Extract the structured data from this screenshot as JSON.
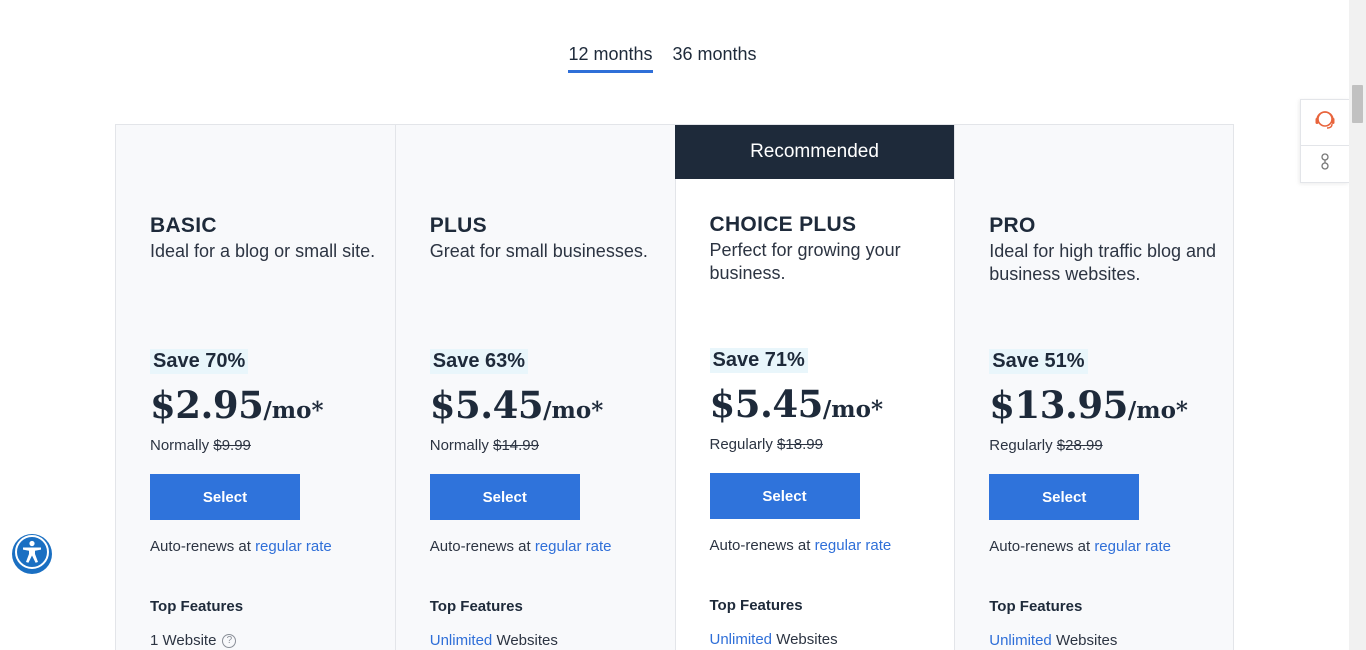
{
  "tabs": [
    {
      "label": "12 months",
      "active": true
    },
    {
      "label": "36 months",
      "active": false
    }
  ],
  "recommended_label": "Recommended",
  "plans": [
    {
      "name": "BASIC",
      "description": "Ideal for a blog or small site.",
      "save": "Save 70%",
      "price": "$2.95",
      "per": "/mo*",
      "normal_label": "Normally",
      "normal_price": "$9.99",
      "select_label": "Select",
      "renew_text": "Auto-renews at ",
      "renew_link": "regular rate",
      "top_features_label": "Top Features",
      "feature_highlight": "",
      "feature_text": "1 Website"
    },
    {
      "name": "PLUS",
      "description": "Great for small businesses.",
      "save": "Save 63%",
      "price": "$5.45",
      "per": "/mo*",
      "normal_label": "Normally",
      "normal_price": "$14.99",
      "select_label": "Select",
      "renew_text": "Auto-renews at ",
      "renew_link": "regular rate",
      "top_features_label": "Top Features",
      "feature_highlight": "Unlimited",
      "feature_text": " Websites"
    },
    {
      "name": "CHOICE PLUS",
      "description": "Perfect for growing your business.",
      "save": "Save 71%",
      "price": "$5.45",
      "per": "/mo*",
      "normal_label": "Regularly",
      "normal_price": "$18.99",
      "select_label": "Select",
      "renew_text": "Auto-renews at ",
      "renew_link": "regular rate",
      "top_features_label": "Top Features",
      "feature_highlight": "Unlimited",
      "feature_text": " Websites"
    },
    {
      "name": "PRO",
      "description": "Ideal for high traffic blog and business websites.",
      "save": "Save 51%",
      "price": "$13.95",
      "per": "/mo*",
      "normal_label": "Regularly",
      "normal_price": "$28.99",
      "select_label": "Select",
      "renew_text": "Auto-renews at ",
      "renew_link": "regular rate",
      "top_features_label": "Top Features",
      "feature_highlight": "Unlimited",
      "feature_text": " Websites"
    }
  ],
  "feature_help_icon": "?",
  "icons": {
    "support": "headset-icon",
    "options": "options-icon",
    "accessibility": "accessibility-icon",
    "help": "help-circle-icon"
  },
  "colors": {
    "accent": "#2f73db",
    "dark": "#1e2a3a",
    "save_bg": "#e9f6fb",
    "support_icon": "#e8643c"
  }
}
